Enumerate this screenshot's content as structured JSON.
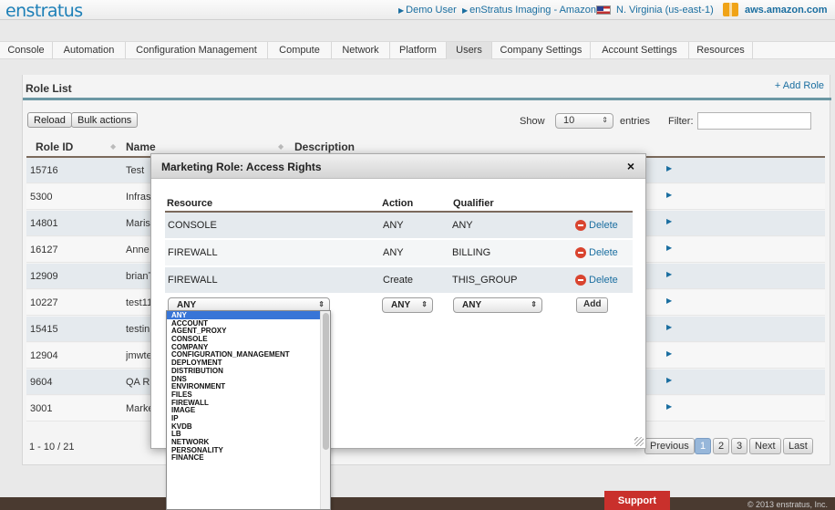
{
  "header": {
    "logo": "enstratus",
    "user": "Demo User",
    "region_context": "enStratus Imaging - Amazon",
    "region": "N. Virginia (us-east-1)",
    "cloud": "aws.amazon.com"
  },
  "nav": {
    "items": [
      "Console",
      "Automation",
      "Configuration Management",
      "Compute",
      "Network",
      "Platform",
      "Users",
      "Company Settings",
      "Account Settings",
      "Resources"
    ],
    "active": "Users"
  },
  "panel": {
    "title": "Role List",
    "add_role": "+ Add Role",
    "reload": "Reload",
    "bulk_actions": "Bulk actions",
    "show_label": "Show",
    "show_value": "10",
    "entries_label": "entries",
    "filter_label": "Filter:",
    "filter_value": ""
  },
  "table": {
    "headers": [
      "Role ID",
      "Name",
      "Description"
    ],
    "rows": [
      {
        "id": "15716",
        "name": "Test"
      },
      {
        "id": "5300",
        "name": "Infras"
      },
      {
        "id": "14801",
        "name": "Maris"
      },
      {
        "id": "16127",
        "name": "Anne"
      },
      {
        "id": "12909",
        "name": "brianT"
      },
      {
        "id": "10227",
        "name": "test11"
      },
      {
        "id": "15415",
        "name": "testin"
      },
      {
        "id": "12904",
        "name": "jmwte"
      },
      {
        "id": "9604",
        "name": "QA R"
      },
      {
        "id": "3001",
        "name": "Marke"
      }
    ]
  },
  "pagination": {
    "info": "1 - 10 / 21",
    "previous": "Previous",
    "pages": [
      "1",
      "2",
      "3"
    ],
    "current": "1",
    "next": "Next",
    "last": "Last"
  },
  "modal": {
    "title": "Marketing Role: Access Rights",
    "close": "×",
    "headers": {
      "resource": "Resource",
      "action": "Action",
      "qualifier": "Qualifier"
    },
    "rows": [
      {
        "resource": "CONSOLE",
        "action": "ANY",
        "qualifier": "ANY",
        "delete": "Delete"
      },
      {
        "resource": "FIREWALL",
        "action": "ANY",
        "qualifier": "BILLING",
        "delete": "Delete"
      },
      {
        "resource": "FIREWALL",
        "action": "Create",
        "qualifier": "THIS_GROUP",
        "delete": "Delete"
      }
    ],
    "new_row": {
      "resource": "ANY",
      "action": "ANY",
      "qualifier": "ANY",
      "add": "Add"
    }
  },
  "dropdown": {
    "options": [
      "ANY",
      "ACCOUNT",
      "AGENT_PROXY",
      "CONSOLE",
      "COMPANY",
      "CONFIGURATION_MANAGEMENT",
      "DEPLOYMENT",
      "DISTRIBUTION",
      "DNS",
      "ENVIRONMENT",
      "FILES",
      "FIREWALL",
      "IMAGE",
      "IP",
      "KVDB",
      "LB",
      "NETWORK",
      "PERSONALITY",
      "FINANCE"
    ],
    "selected": "ANY"
  },
  "footer": {
    "support": "Support",
    "copyright": "© 2013 enstratus, Inc."
  },
  "colors": {
    "brand": "#1c7fb7",
    "panel_bar": "#6b97a3",
    "delete": "#d9442f",
    "support": "#c9302c",
    "selected_option": "#3875d7"
  }
}
